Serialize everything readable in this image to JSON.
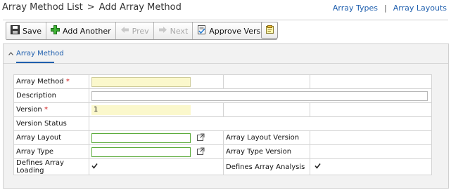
{
  "header": {
    "breadcrumb_parent": "Array Method List",
    "breadcrumb_separator": ">",
    "breadcrumb_current": "Add Array Method",
    "links": {
      "array_types": "Array Types",
      "divider": "|",
      "array_layouts": "Array Layouts"
    }
  },
  "toolbar": {
    "save_label": "Save",
    "add_another_label": "Add Another",
    "prev_label": "Prev",
    "next_label": "Next",
    "approve_label": "Approve Version"
  },
  "section": {
    "tab_label": "Array Method"
  },
  "form": {
    "array_method_label": "Array Method",
    "required_marker": "*",
    "array_method_value": "",
    "description_label": "Description",
    "description_value": "",
    "version_label": "Version",
    "version_value": "1",
    "version_status_label": "Version Status",
    "version_status_value": "",
    "array_layout_label": "Array Layout",
    "array_layout_value": "",
    "array_layout_version_label": "Array Layout Version",
    "array_type_label": "Array Type",
    "array_type_value": "",
    "array_type_version_label": "Array Type Version",
    "defines_loading_label": "Defines Array Loading",
    "defines_loading_checked": true,
    "defines_analysis_label": "Defines Array Analysis",
    "defines_analysis_checked": true
  },
  "colors": {
    "link": "#1f5fae",
    "required_bg": "#fbf8cc",
    "required_marker": "#d01818"
  }
}
